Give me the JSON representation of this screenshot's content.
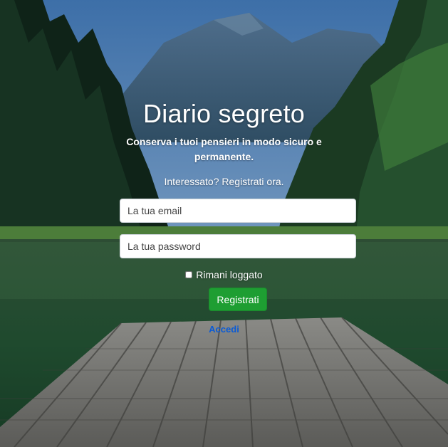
{
  "header": {
    "title": "Diario segreto",
    "subtitle": "Conserva i tuoi pensieri in modo sicuro e permanente.",
    "cta": "Interessato? Registrati ora."
  },
  "form": {
    "email_placeholder": "La tua email",
    "password_placeholder": "La tua password",
    "remember_label": "Rimani loggato",
    "submit_label": "Registrati",
    "alt_link_label": "Accedi"
  },
  "colors": {
    "submit": "#1e9e32",
    "link": "#0a5bd6"
  }
}
